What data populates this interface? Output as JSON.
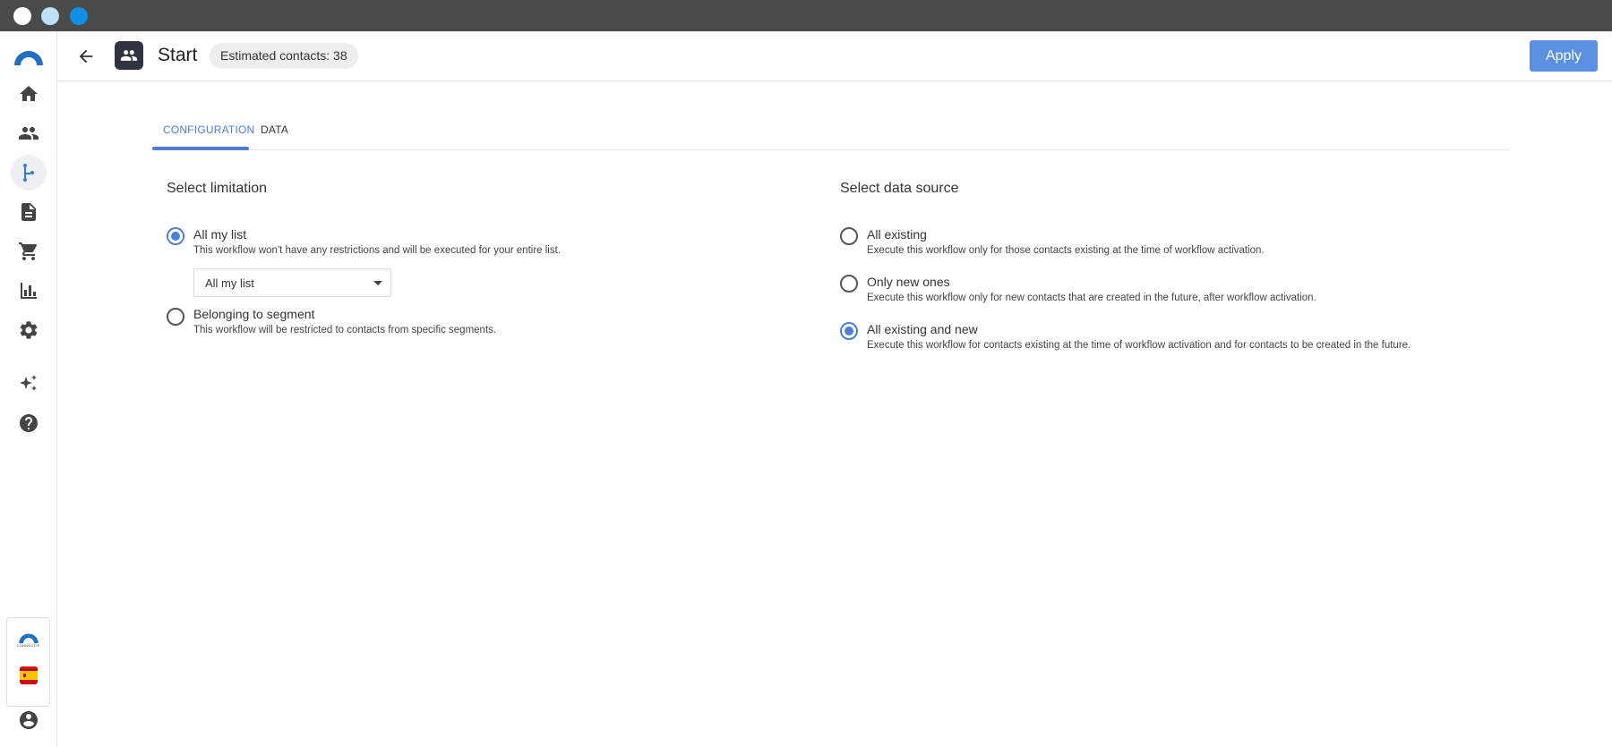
{
  "window": {
    "buttons": [
      "close",
      "minimize",
      "maximize"
    ]
  },
  "sidebar": {
    "items": [
      {
        "name": "home-icon",
        "active": false
      },
      {
        "name": "people-icon",
        "active": false
      },
      {
        "name": "workflow-icon",
        "active": true
      },
      {
        "name": "document-icon",
        "active": false
      },
      {
        "name": "cart-icon",
        "active": false
      },
      {
        "name": "bar-chart-icon",
        "active": false
      },
      {
        "name": "gear-icon",
        "active": false
      },
      {
        "name": "sparkles-icon",
        "active": false
      },
      {
        "name": "help-icon",
        "active": false
      }
    ],
    "account_logo_text": "CONNECTIF",
    "language_flag": "spain-flag-icon",
    "profile_icon": "account-circle-icon"
  },
  "header": {
    "title": "Start",
    "estimated_contacts": "Estimated contacts: 38",
    "apply_label": "Apply",
    "accent_color": "#5b8fe0"
  },
  "tabs": [
    {
      "label": "CONFIGURATION",
      "active": true
    },
    {
      "label": "DATA",
      "active": false
    }
  ],
  "limitation": {
    "title": "Select limitation",
    "options": [
      {
        "label": "All my list",
        "description": "This workflow won't have any restrictions and will be executed for your entire list.",
        "checked": true
      },
      {
        "label": "Belonging to segment",
        "description": "This workflow will be restricted to contacts from specific segments.",
        "checked": false
      }
    ],
    "select": {
      "value": "All my list"
    }
  },
  "data_source": {
    "title": "Select data source",
    "options": [
      {
        "label": "All existing",
        "description": "Execute this workflow only for those contacts existing at the time of workflow activation.",
        "checked": false
      },
      {
        "label": "Only new ones",
        "description": "Execute this workflow only for new contacts that are created in the future, after workflow activation.",
        "checked": false
      },
      {
        "label": "All existing and new",
        "description": "Execute this workflow for contacts existing at the time of workflow activation and for contacts to be created in the future.",
        "checked": true
      }
    ]
  }
}
